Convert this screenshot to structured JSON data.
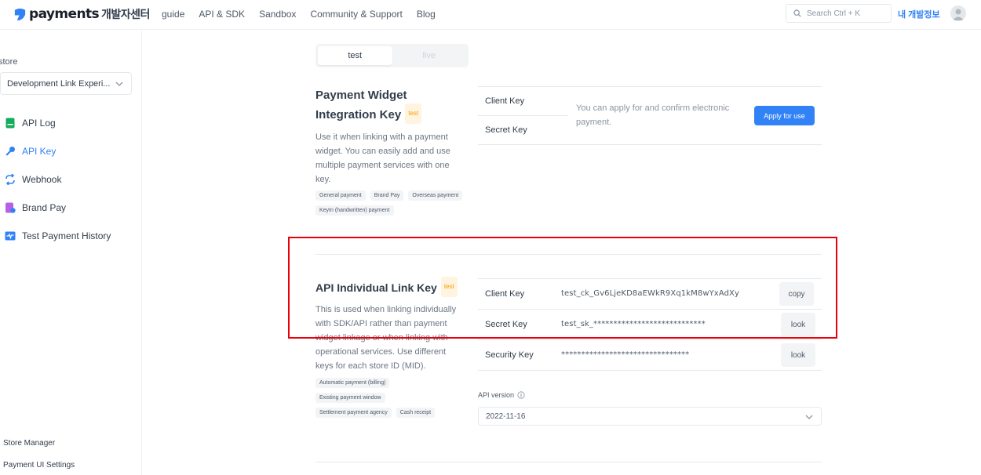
{
  "brand": {
    "name": "payments",
    "suffix": "개발자센터",
    "accent": "#3182f6"
  },
  "nav": {
    "links": [
      "guide",
      "API & SDK",
      "Sandbox",
      "Community & Support",
      "Blog"
    ],
    "search_placeholder": "Search Ctrl + K",
    "my_info": "내 개발정보"
  },
  "sidebar": {
    "store_label": "store",
    "store_value": "Development Link Experi...",
    "items": [
      {
        "label": "API Log",
        "icon": "api-log-icon",
        "active": false
      },
      {
        "label": "API Key",
        "icon": "key-icon",
        "active": true
      },
      {
        "label": "Webhook",
        "icon": "webhook-icon",
        "active": false
      },
      {
        "label": "Brand Pay",
        "icon": "brand-pay-icon",
        "active": false
      },
      {
        "label": "Test Payment History",
        "icon": "payment-history-icon",
        "active": false
      }
    ],
    "bottom_items": [
      "Store Manager",
      "Payment UI Settings"
    ]
  },
  "mode_toggle": {
    "options": [
      "test",
      "live"
    ],
    "selected": "test"
  },
  "widget_section": {
    "title_line1": "Payment Widget",
    "title_line2": "Integration Key",
    "badge": "test",
    "description": "Use it when linking with a payment widget. You can easily add and use multiple payment services with one key.",
    "chips": [
      "General payment",
      "Brand Pay",
      "Overseas payment",
      "KeyIn (handwritten) payment"
    ],
    "client_key_label": "Client Key",
    "secret_key_label": "Secret Key",
    "apply_text": "You can apply for and confirm electronic payment.",
    "apply_button": "Apply for use"
  },
  "api_section": {
    "title": "API Individual Link Key",
    "badge": "test",
    "description": "This is used when linking individually with SDK/API rather than payment widget linkage or when linking with operational services. Use different keys for each store ID (MID).",
    "chips": [
      "Automatic payment (billing)",
      "Existing payment window",
      "Settlement payment agency",
      "Cash receipt"
    ],
    "keys": [
      {
        "label": "Client Key",
        "value": "test_ck_Gv6LjeKD8aEWkR9Xq1kM8wYxAdXy",
        "button": "copy"
      },
      {
        "label": "Secret Key",
        "value": "test_sk_****************************",
        "button": "look"
      },
      {
        "label": "Security Key",
        "value": "********************************",
        "button": "look"
      }
    ],
    "api_version_label": "API version",
    "api_version_value": "2022-11-16"
  }
}
